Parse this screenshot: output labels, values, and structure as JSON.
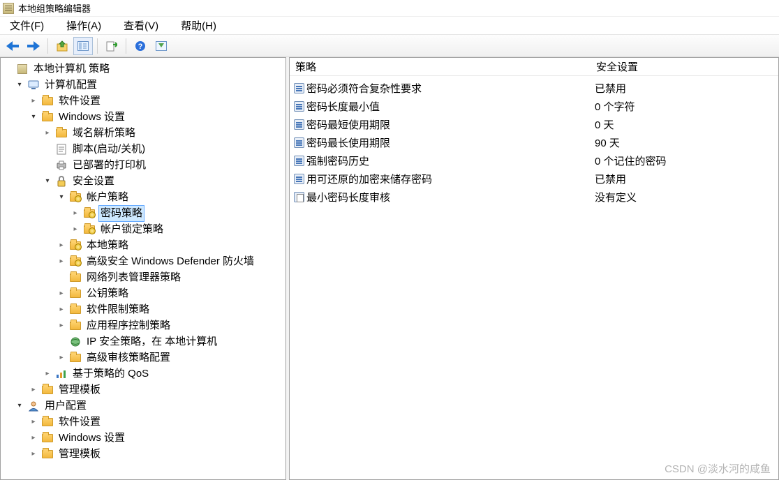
{
  "title": "本地组策略编辑器",
  "menu": {
    "file": "文件(F)",
    "action": "操作(A)",
    "view": "查看(V)",
    "help": "帮助(H)"
  },
  "tree": {
    "root": "本地计算机 策略",
    "computer_config": "计算机配置",
    "software_settings": "软件设置",
    "windows_settings": "Windows 设置",
    "dns_policy": "域名解析策略",
    "scripts": "脚本(启动/关机)",
    "deployed_printers": "已部署的打印机",
    "security_settings": "安全设置",
    "account_policies": "帐户策略",
    "password_policy": "密码策略",
    "account_lockout": "帐户锁定策略",
    "local_policies": "本地策略",
    "defender_fw": "高级安全 Windows Defender 防火墙",
    "network_list": "网络列表管理器策略",
    "public_key": "公钥策略",
    "software_restriction": "软件限制策略",
    "app_control": "应用程序控制策略",
    "ip_sec": "IP 安全策略，在 本地计算机",
    "adv_audit": "高级审核策略配置",
    "policy_qos": "基于策略的 QoS",
    "admin_templates": "管理模板",
    "user_config": "用户配置",
    "u_software": "软件设置",
    "u_windows": "Windows 设置",
    "u_admin": "管理模板"
  },
  "list": {
    "header_policy": "策略",
    "header_setting": "安全设置",
    "rows": [
      {
        "name": "密码必须符合复杂性要求",
        "value": "已禁用",
        "type": "reg"
      },
      {
        "name": "密码长度最小值",
        "value": "0 个字符",
        "type": "reg"
      },
      {
        "name": "密码最短使用期限",
        "value": "0 天",
        "type": "reg"
      },
      {
        "name": "密码最长使用期限",
        "value": "90 天",
        "type": "reg"
      },
      {
        "name": "强制密码历史",
        "value": "0 个记住的密码",
        "type": "reg"
      },
      {
        "name": "用可还原的加密来储存密码",
        "value": "已禁用",
        "type": "reg"
      },
      {
        "name": "最小密码长度审核",
        "value": "没有定义",
        "type": "doc"
      }
    ]
  },
  "watermark": "CSDN @淡水河的咸鱼"
}
